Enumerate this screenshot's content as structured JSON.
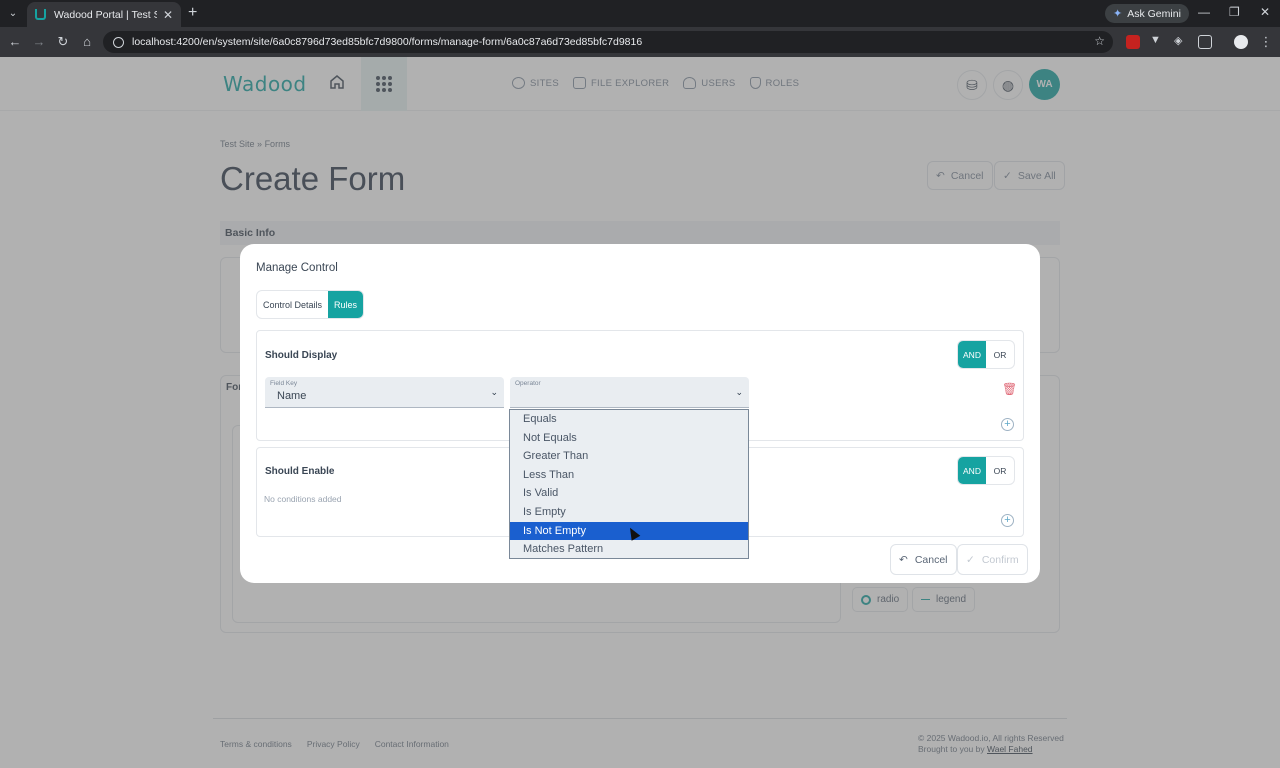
{
  "browser": {
    "tab_title": "Wadood Portal | Test Site - Cre…",
    "url": "localhost:4200/en/system/site/6a0c8796d73ed85bfc7d9800/forms/manage-form/6a0c87a6d73ed85bfc7d9816",
    "gemini_label": "Ask Gemini"
  },
  "header": {
    "logo": "Wadood",
    "nav": [
      {
        "label": "SITES",
        "icon": "globe-icon"
      },
      {
        "label": "FILE EXPLORER",
        "icon": "folder-icon"
      },
      {
        "label": "USERS",
        "icon": "users-icon"
      },
      {
        "label": "ROLES",
        "icon": "shield-icon"
      }
    ],
    "avatar_initials": "WA"
  },
  "page": {
    "breadcrumb_site": "Test Site",
    "breadcrumb_sep": "»",
    "breadcrumb_current": "Forms",
    "title": "Create Form",
    "cancel_label": "Cancel",
    "save_all_label": "Save All",
    "basic_info_label": "Basic Info",
    "form_section_label": "For",
    "chips": [
      "radio",
      "legend"
    ]
  },
  "modal": {
    "title": "Manage Control",
    "tabs": [
      "Control Details",
      "Rules"
    ],
    "active_tab": "Rules",
    "should_display": {
      "title": "Should Display",
      "and_label": "AND",
      "or_label": "OR",
      "field_key_label": "Field Key",
      "field_key_value": "Name",
      "operator_label": "Operator",
      "operator_value": ""
    },
    "should_enable": {
      "title": "Should Enable",
      "and_label": "AND",
      "or_label": "OR",
      "empty_text": "No conditions added"
    },
    "cancel_label": "Cancel",
    "confirm_label": "Confirm"
  },
  "operator_options": [
    "Equals",
    "Not Equals",
    "Greater Than",
    "Less Than",
    "Is Valid",
    "Is Empty",
    "Is Not Empty",
    "Matches Pattern"
  ],
  "operator_highlighted": "Is Not Empty",
  "footer": {
    "links": [
      "Terms & conditions",
      "Privacy Policy",
      "Contact Information"
    ],
    "copyright": "© 2025 Wadood.io, All rights Reserved",
    "brought_by": "Brought to you by",
    "author": "Wael Fahed"
  },
  "colors": {
    "accent": "#16a3a1",
    "highlight": "#1a5fcf"
  }
}
